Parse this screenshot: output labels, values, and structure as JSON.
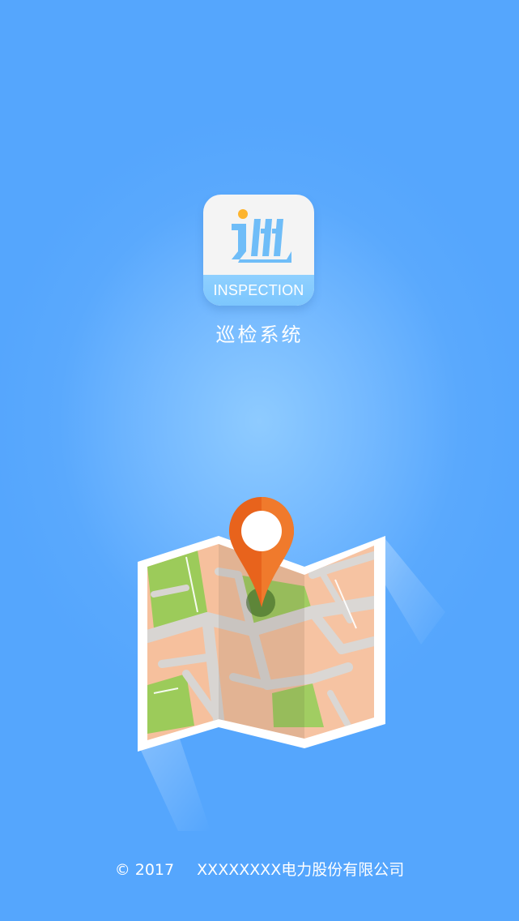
{
  "app_icon": {
    "band_text": "INSPECTION"
  },
  "app_title": "巡检系统",
  "footer": {
    "copyright": "© 2017",
    "company": "XXXXXXXX电力股份有限公司"
  },
  "colors": {
    "background": "#5aa9fd",
    "icon_band": "#7cc6fd",
    "icon_glyph": "#6fbdf8",
    "icon_dot": "#fdb42e",
    "pin": "#e8631c",
    "map_land": "#f6c09d",
    "map_park": "#9ccb5a",
    "map_road": "#d8d5d2"
  }
}
